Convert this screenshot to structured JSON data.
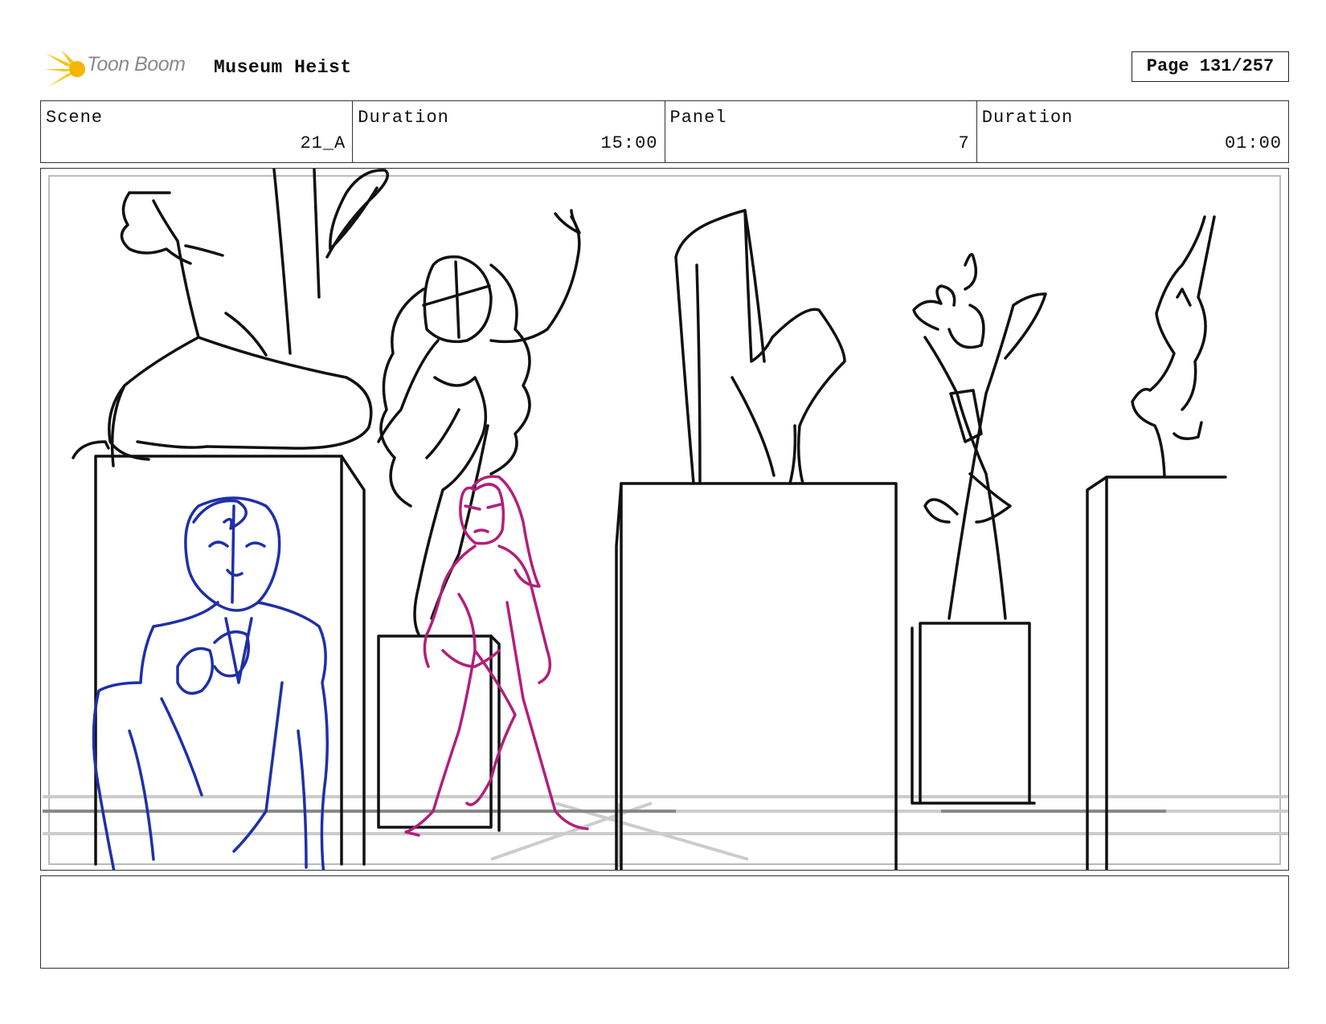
{
  "header": {
    "logo_text": "Toon Boom",
    "project_title": "Museum Heist",
    "page": "Page 131/257"
  },
  "info": [
    {
      "label": "Scene",
      "value": "21_A"
    },
    {
      "label": "Duration",
      "value": "15:00"
    },
    {
      "label": "Panel",
      "value": "7"
    },
    {
      "label": "Duration",
      "value": "01:00"
    }
  ],
  "colors": {
    "logo_accent": "#f5c518",
    "sketch_black": "#111111",
    "sketch_blue": "#1f2fa8",
    "sketch_magenta": "#b0207a",
    "floor_grey": "#cccccc"
  },
  "caption": ""
}
